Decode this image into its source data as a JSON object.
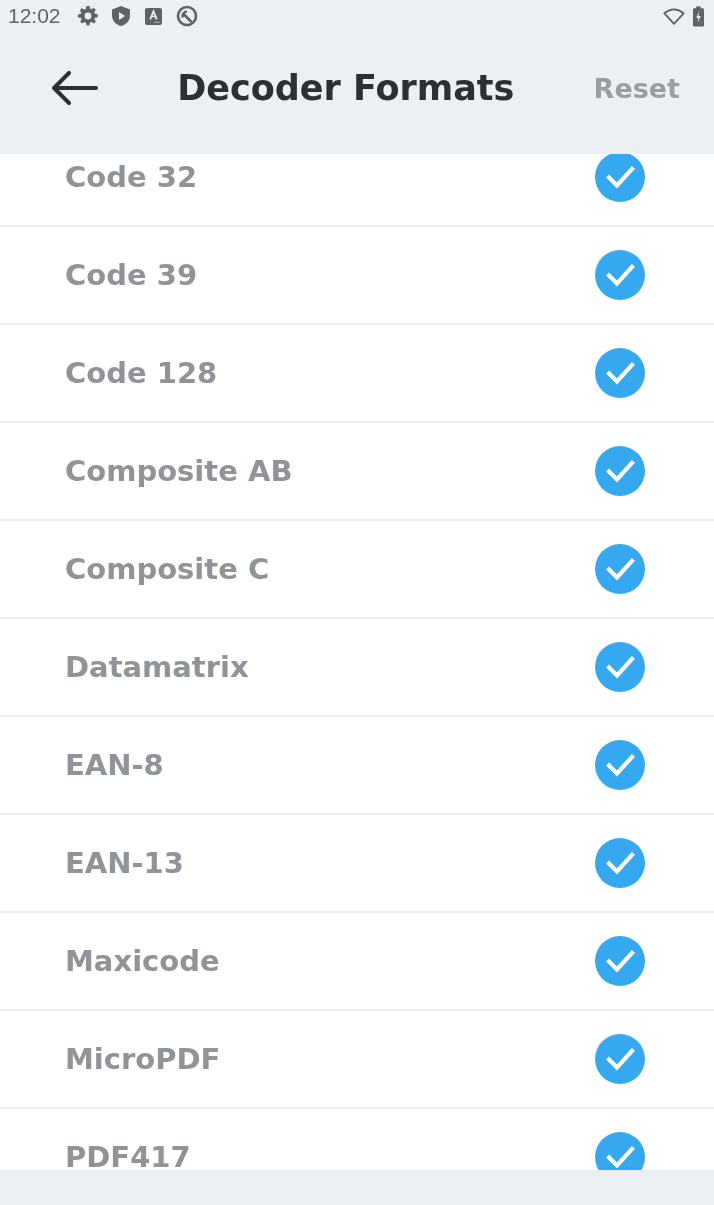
{
  "status_bar": {
    "time": "12:02"
  },
  "app_bar": {
    "title": "Decoder Formats",
    "reset": {
      "label": "Reset",
      "disabled": true
    }
  },
  "formats": [
    {
      "name": "Code 32",
      "checked": true
    },
    {
      "name": "Code 39",
      "checked": true
    },
    {
      "name": "Code 128",
      "checked": true
    },
    {
      "name": "Composite AB",
      "checked": true
    },
    {
      "name": "Composite C",
      "checked": true
    },
    {
      "name": "Datamatrix",
      "checked": true
    },
    {
      "name": "EAN-8",
      "checked": true
    },
    {
      "name": "EAN-13",
      "checked": true
    },
    {
      "name": "Maxicode",
      "checked": true
    },
    {
      "name": "MicroPDF",
      "checked": true
    },
    {
      "name": "PDF417",
      "checked": true
    }
  ]
}
